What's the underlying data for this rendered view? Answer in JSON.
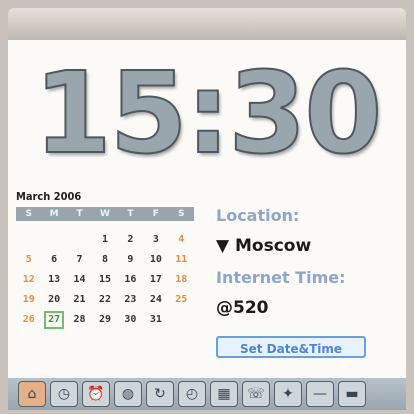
{
  "clock": {
    "time": "15:30"
  },
  "calendar": {
    "title": "March 2006",
    "weekdays": [
      "S",
      "M",
      "T",
      "W",
      "T",
      "F",
      "S"
    ],
    "weeks": [
      [
        "",
        "",
        "",
        "1",
        "2",
        "3",
        "4"
      ],
      [
        "5",
        "6",
        "7",
        "8",
        "9",
        "10",
        "11"
      ],
      [
        "12",
        "13",
        "14",
        "15",
        "16",
        "17",
        "18"
      ],
      [
        "19",
        "20",
        "21",
        "22",
        "23",
        "24",
        "25"
      ],
      [
        "26",
        "27",
        "28",
        "29",
        "30",
        "31",
        ""
      ]
    ],
    "today": "27"
  },
  "location": {
    "label": "Location:",
    "value": "Moscow"
  },
  "internet_time": {
    "label": "Internet Time:",
    "value": "@520"
  },
  "buttons": {
    "set_datetime": "Set Date&Time"
  },
  "toolbar": {
    "icons": [
      "home-icon",
      "clock-icon",
      "alarm-icon",
      "world-icon",
      "sync-icon",
      "timer-icon",
      "calendar-icon",
      "phone-icon",
      "settings-icon",
      "minimize-icon",
      "close-icon"
    ]
  },
  "colors": {
    "accent_label": "#8da7cc",
    "weekend": "#ee8a3c",
    "today_border": "#6fc06f",
    "button": "#4d86d9"
  }
}
